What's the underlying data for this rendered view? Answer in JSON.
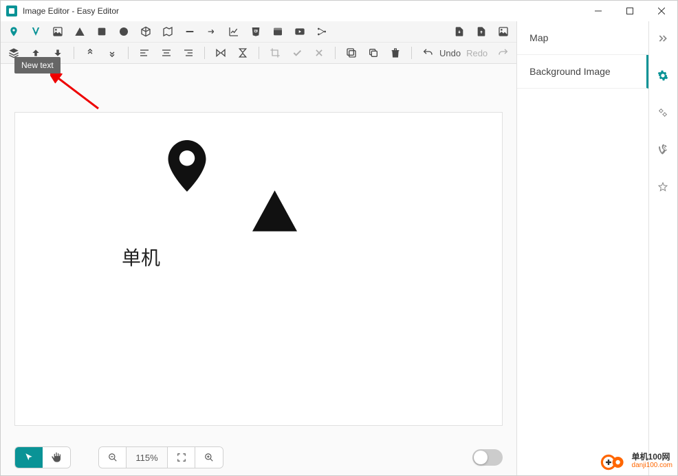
{
  "titlebar": {
    "title": "Image Editor - Easy Editor"
  },
  "toolbar": {
    "tooltip": "New text",
    "undo_label": "Undo",
    "redo_label": "Redo"
  },
  "canvas": {
    "text1": "单机"
  },
  "bottom": {
    "zoom": "115%"
  },
  "right_panel": {
    "items": [
      {
        "label": "Map"
      },
      {
        "label": "Background Image"
      }
    ]
  },
  "watermark": {
    "cn": "单机100网",
    "en": "danji100.com"
  },
  "colors": {
    "accent": "#0a9396"
  }
}
